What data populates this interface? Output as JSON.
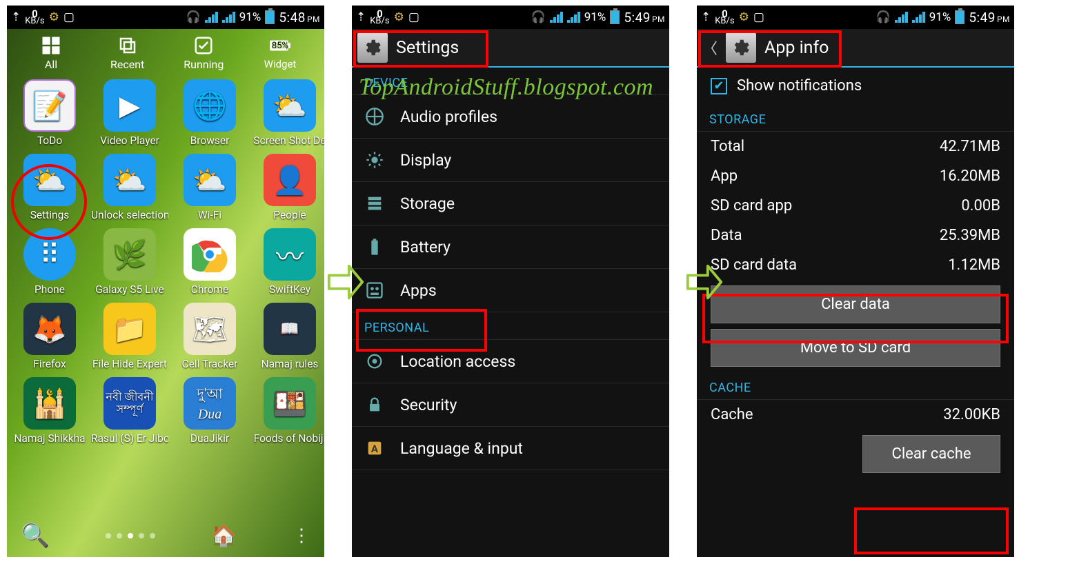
{
  "watermark": "TopAndroidStuff.blogspot.com",
  "statusbar": {
    "kb_value": "0",
    "kb_unit": "KB/s",
    "battery_pct": "91%",
    "time1": "5:48",
    "time2": "5:49",
    "ampm": "PM"
  },
  "phone1": {
    "tabs": {
      "all": "All",
      "recent": "Recent",
      "running": "Running",
      "widget": "Widget"
    },
    "battery_widget": "85%",
    "apps": [
      "ToDo",
      "Video Player",
      "Browser",
      "Screen Shot De",
      "Settings",
      "Unlock selection",
      "Wi-Fi",
      "People",
      "Phone",
      "Galaxy S5 Live",
      "Chrome",
      "SwiftKey",
      "Firefox",
      "File Hide Expert",
      "Cell Tracker",
      "Namaj rules",
      "Namaj Shikkha",
      "Rasul (S) Er Jibon",
      "DuaJikir",
      "Foods of Nobiji"
    ]
  },
  "phone2": {
    "title": "Settings",
    "section_device": "DEVICE",
    "section_personal": "PERSONAL",
    "items_device": [
      "Audio profiles",
      "Display",
      "Storage",
      "Battery",
      "Apps"
    ],
    "items_personal": [
      "Location access",
      "Security",
      "Language & input"
    ]
  },
  "phone3": {
    "title": "App info",
    "show_notifications": "Show notifications",
    "section_storage": "STORAGE",
    "section_cache": "CACHE",
    "storage": {
      "total_k": "Total",
      "total_v": "42.71MB",
      "app_k": "App",
      "app_v": "16.20MB",
      "sdapp_k": "SD card app",
      "sdapp_v": "0.00B",
      "data_k": "Data",
      "data_v": "25.39MB",
      "sddata_k": "SD card data",
      "sddata_v": "1.12MB"
    },
    "clear_data": "Clear data",
    "move_sd": "Move to SD card",
    "cache_k": "Cache",
    "cache_v": "32.00KB",
    "clear_cache": "Clear cache"
  }
}
